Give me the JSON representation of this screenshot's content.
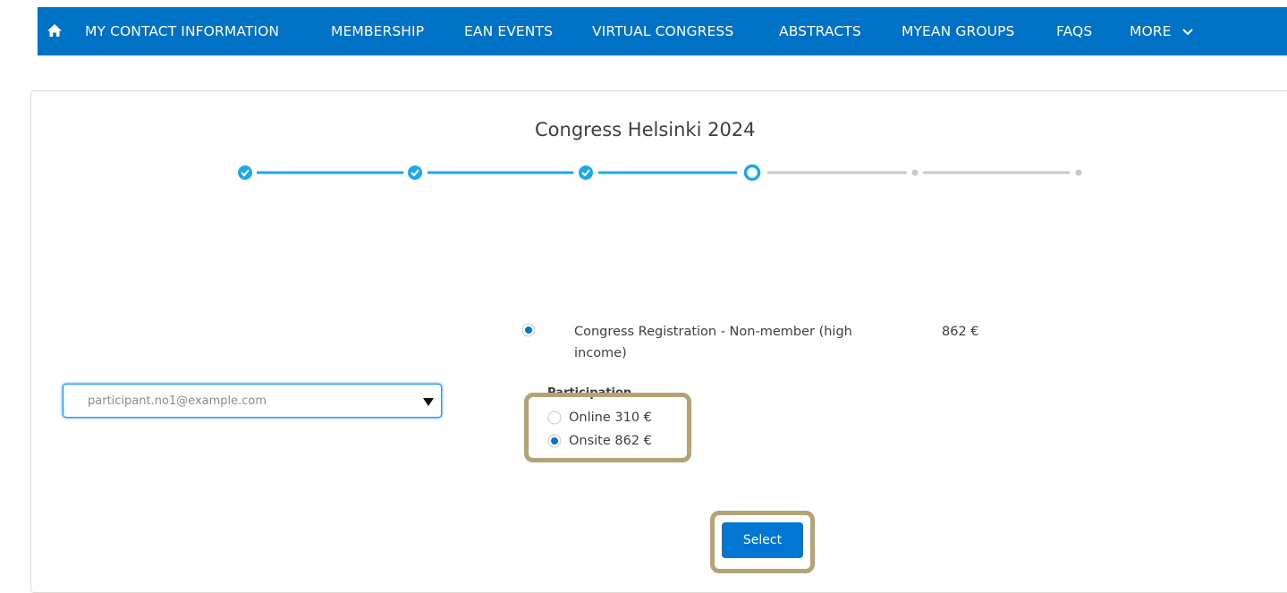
{
  "nav": {
    "items": [
      "MY CONTACT INFORMATION",
      "MEMBERSHIP",
      "EAN EVENTS",
      "VIRTUAL CONGRESS",
      "ABSTRACTS",
      "MYEAN GROUPS",
      "FAQS",
      "MORE"
    ]
  },
  "page": {
    "title": "Congress Helsinki 2024"
  },
  "stepper": {
    "completed_steps": 3,
    "current_step": 4,
    "total_steps": 6
  },
  "participant": {
    "selected": "participant.no1@example.com"
  },
  "registration": {
    "label": "Congress Registration - Non-member (high income)",
    "price": "862 €",
    "selected": true
  },
  "participation": {
    "label": "Participation",
    "options": [
      {
        "label": "Online 310  €",
        "selected": false
      },
      {
        "label": "Onsite 862  €",
        "selected": true
      }
    ]
  },
  "actions": {
    "select_label": "Select"
  },
  "colors": {
    "nav_bg": "#0072c6",
    "step_done": "#1ba9e8",
    "step_todo": "#c9c9c9",
    "button": "#0176d3",
    "highlight": "#b3a377"
  }
}
